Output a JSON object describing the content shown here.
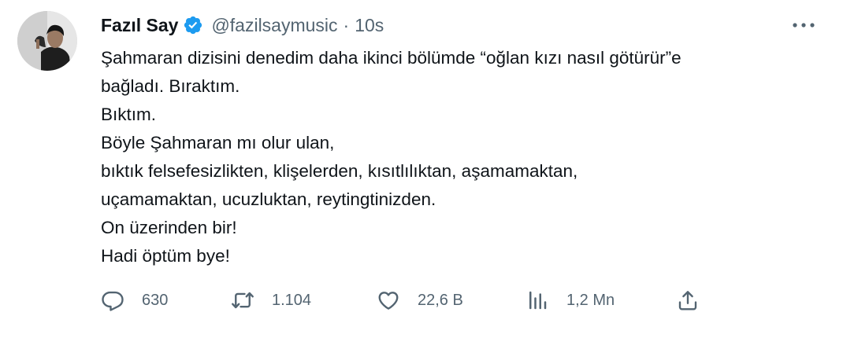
{
  "author": {
    "display_name": "Fazıl Say",
    "handle": "@fazilsaymusic",
    "separator": "·",
    "time": "10s",
    "verified_icon": "verified-badge-icon"
  },
  "tweet": {
    "lines": [
      "Şahmaran dizisini denedim daha ikinci bölümde “oğlan kızı nasıl götürür”e",
      "bağladı. Bıraktım.",
      "Bıktım.",
      "Böyle Şahmaran mı olur ulan,",
      "bıktık felsefesizlikten, klişelerden, kısıtlılıktan, aşamamaktan,",
      "uçamamaktan, ucuzluktan, reytingtinizden.",
      "On üzerinden bir!",
      "Hadi öptüm bye!"
    ]
  },
  "actions": {
    "reply": {
      "icon": "reply-icon",
      "count": "630"
    },
    "retweet": {
      "icon": "retweet-icon",
      "count": "1.104"
    },
    "like": {
      "icon": "heart-icon",
      "count": "22,6 B"
    },
    "views": {
      "icon": "views-icon",
      "count": "1,2 Mn"
    },
    "share": {
      "icon": "share-icon"
    }
  },
  "colors": {
    "text": "#0f1419",
    "secondary": "#536471",
    "verified": "#1d9bf0"
  }
}
